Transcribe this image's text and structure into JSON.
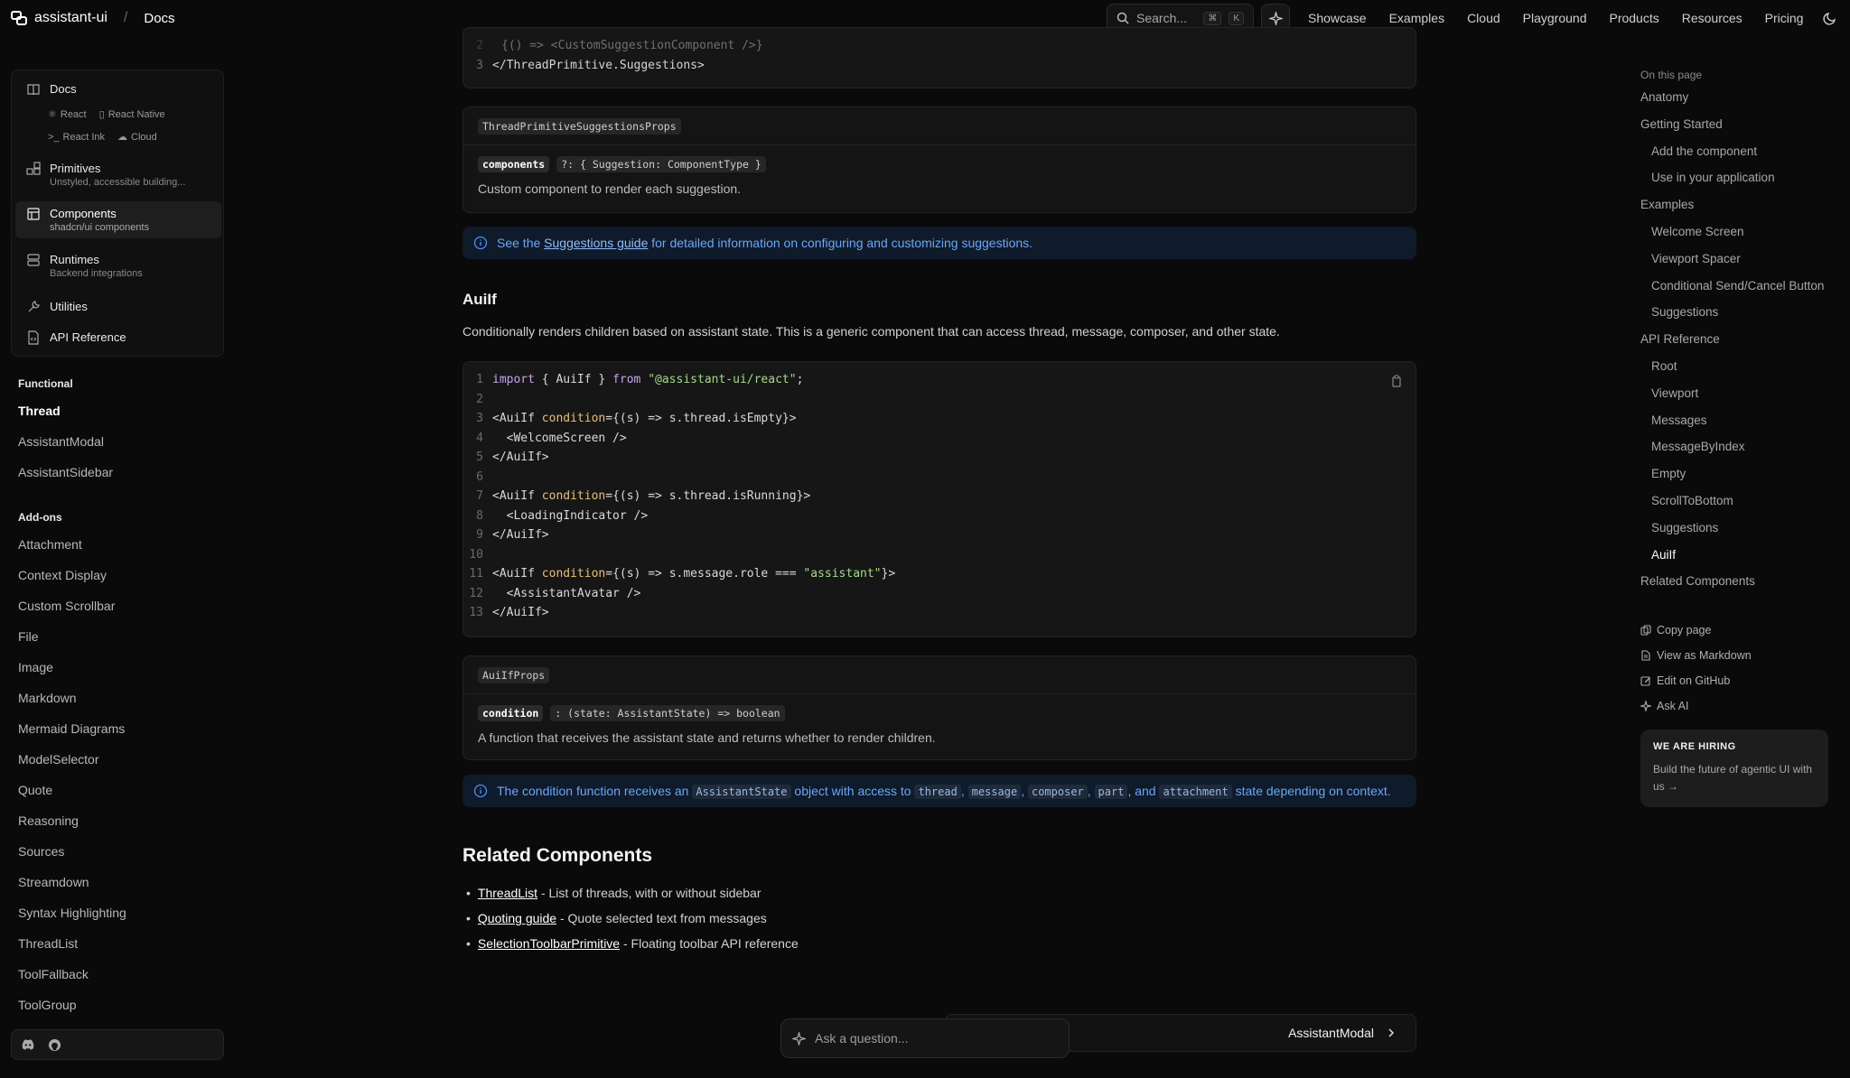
{
  "header": {
    "brand": "assistant-ui",
    "crumb_sep": "/",
    "crumb": "Docs",
    "search_placeholder": "Search...",
    "kbd_cmd": "⌘",
    "kbd_k": "K",
    "nav": [
      "Showcase",
      "Examples",
      "Cloud",
      "Playground",
      "Products",
      "Resources",
      "Pricing"
    ]
  },
  "sidebar": {
    "docs_card": {
      "docs": "Docs",
      "sub_links": [
        "React",
        "React Native",
        "React Ink",
        "Cloud"
      ],
      "items": [
        {
          "title": "Primitives",
          "subtitle": "Unstyled, accessible building..."
        },
        {
          "title": "Components",
          "subtitle": "shadcn/ui components"
        },
        {
          "title": "Runtimes",
          "subtitle": "Backend integrations"
        },
        {
          "title": "Utilities",
          "subtitle": ""
        },
        {
          "title": "API Reference",
          "subtitle": ""
        }
      ]
    },
    "functional_heading": "Functional",
    "functional": [
      "Thread",
      "AssistantModal",
      "AssistantSidebar"
    ],
    "addons_heading": "Add-ons",
    "addons": [
      "Attachment",
      "Context Display",
      "Custom Scrollbar",
      "File",
      "Image",
      "Markdown",
      "Mermaid Diagrams",
      "ModelSelector",
      "Quote",
      "Reasoning",
      "Sources",
      "Streamdown",
      "Syntax Highlighting",
      "ThreadList",
      "ToolFallback",
      "ToolGroup"
    ]
  },
  "main": {
    "top_code": {
      "lines": [
        {
          "n": "2",
          "text": "{() => <CustomSuggestionComponent />}"
        },
        {
          "n": "3",
          "text": "</ThreadPrimitive.Suggestions>"
        }
      ]
    },
    "props1": {
      "name": "ThreadPrimitiveSuggestionsProps",
      "prop": "components",
      "type": "?: { Suggestion: ComponentType }",
      "desc": "Custom component to render each suggestion."
    },
    "note1": {
      "pre": "See the",
      "link": "Suggestions guide",
      "post": "for detailed information on configuring and customizing suggestions."
    },
    "auiif": {
      "heading": "AuiIf",
      "desc": "Conditionally renders children based on assistant state. This is a generic component that can access thread, message, composer, and other state."
    },
    "code": [
      {
        "n": "1",
        "t": "import { AuiIf } from \"@assistant-ui/react\";"
      },
      {
        "n": "2",
        "t": ""
      },
      {
        "n": "3",
        "t": "<AuiIf condition={(s) => s.thread.isEmpty}>"
      },
      {
        "n": "4",
        "t": "  <WelcomeScreen />"
      },
      {
        "n": "5",
        "t": "</AuiIf>"
      },
      {
        "n": "6",
        "t": ""
      },
      {
        "n": "7",
        "t": "<AuiIf condition={(s) => s.thread.isRunning}>"
      },
      {
        "n": "8",
        "t": "  <LoadingIndicator />"
      },
      {
        "n": "9",
        "t": "</AuiIf>"
      },
      {
        "n": "10",
        "t": ""
      },
      {
        "n": "11",
        "t": "<AuiIf condition={(s) => s.message.role === \"assistant\"}>"
      },
      {
        "n": "12",
        "t": "  <AssistantAvatar />"
      },
      {
        "n": "13",
        "t": "</AuiIf>"
      }
    ],
    "props2": {
      "name": "AuiIfProps",
      "prop": "condition",
      "type": ": (state: AssistantState) => boolean",
      "desc": "A function that receives the assistant state and returns whether to render children."
    },
    "note2": {
      "pre": "The condition function receives an",
      "c1": "AssistantState",
      "mid": "object with access to",
      "c2": "thread",
      "c3": "message",
      "c4": "composer",
      "c5": "part",
      "and": ", and",
      "c6": "attachment",
      "post": "state depending on context."
    },
    "related": {
      "heading": "Related Components",
      "items": [
        {
          "link": "ThreadList",
          "text": " - List of threads, with or without sidebar"
        },
        {
          "link": "Quoting guide",
          "text": " - Quote selected text from messages"
        },
        {
          "link": "SelectionToolbarPrimitive",
          "text": " - Floating toolbar API reference"
        }
      ]
    },
    "next_page": "AssistantModal",
    "ask_placeholder": "Ask a question..."
  },
  "toc": {
    "heading": "On this page",
    "items": [
      {
        "label": "Anatomy",
        "sub": false
      },
      {
        "label": "Getting Started",
        "sub": false
      },
      {
        "label": "Add the component",
        "sub": true
      },
      {
        "label": "Use in your application",
        "sub": true
      },
      {
        "label": "Examples",
        "sub": false
      },
      {
        "label": "Welcome Screen",
        "sub": true
      },
      {
        "label": "Viewport Spacer",
        "sub": true
      },
      {
        "label": "Conditional Send/Cancel Button",
        "sub": true
      },
      {
        "label": "Suggestions",
        "sub": true
      },
      {
        "label": "API Reference",
        "sub": false
      },
      {
        "label": "Root",
        "sub": true
      },
      {
        "label": "Viewport",
        "sub": true
      },
      {
        "label": "Messages",
        "sub": true
      },
      {
        "label": "MessageByIndex",
        "sub": true
      },
      {
        "label": "Empty",
        "sub": true
      },
      {
        "label": "ScrollToBottom",
        "sub": true
      },
      {
        "label": "Suggestions",
        "sub": true
      },
      {
        "label": "AuiIf",
        "sub": true,
        "active": true
      },
      {
        "label": "Related Components",
        "sub": false
      }
    ],
    "actions": [
      "Copy page",
      "View as Markdown",
      "Edit on GitHub",
      "Ask AI"
    ],
    "hiring_title": "WE ARE HIRING",
    "hiring_body": "Build the future of agentic UI with us →"
  },
  "colors": {
    "accent_blue": "#6aa7f5",
    "background": "#0a0a0a"
  }
}
